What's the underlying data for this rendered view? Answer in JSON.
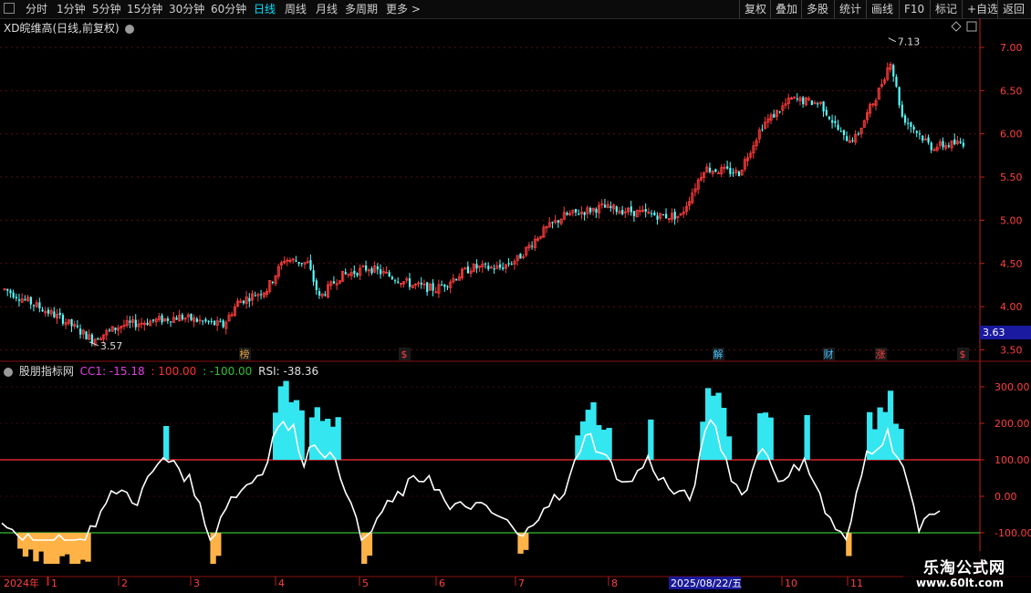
{
  "toolbar": {
    "periods": [
      "分时",
      "1分钟",
      "5分钟",
      "15分钟",
      "30分钟",
      "60分钟",
      "日线",
      "周线",
      "月线",
      "多周期",
      "更多"
    ],
    "active": "日线",
    "more_arrow": ">",
    "right_items": [
      "复权",
      "叠加",
      "多股",
      "统计",
      "画线",
      "F10",
      "标记",
      "+自选",
      "返回"
    ]
  },
  "chart": {
    "title": "XD皖维高(日线,前复权)",
    "high_label": "7.13",
    "low_label": "3.57",
    "current_price_tag": "3.63",
    "price_ticks": [
      "7.00",
      "6.50",
      "6.00",
      "5.50",
      "5.00",
      "4.50",
      "4.00",
      "3.50"
    ],
    "event_markers": [
      {
        "text": "榜",
        "color": "#e0a040"
      },
      {
        "text": "$",
        "color": "#ff4040"
      },
      {
        "text": "解",
        "color": "#40c0ff"
      },
      {
        "text": "财",
        "color": "#40c0ff"
      },
      {
        "text": "涨",
        "color": "#ff4040"
      },
      {
        "text": "$",
        "color": "#ff4040"
      }
    ]
  },
  "indicator": {
    "name": "股朋指标网",
    "cc1": "CC1: -15.18",
    "up_value": ": 100.00",
    "down_value": ": -100.00",
    "rsi": "RSI: -38.36",
    "ticks": [
      "300.00",
      "200.00",
      "100.00",
      "0.00",
      "-100.00"
    ]
  },
  "date_axis": {
    "year_label": "2024年",
    "months": [
      "1",
      "2",
      "3",
      "4",
      "5",
      "6",
      "7",
      "8",
      "10",
      "11"
    ],
    "cursor_date": "2025/08/22/五"
  },
  "watermark": {
    "main": "乐淘公式网",
    "sub": "www.60lt.com"
  },
  "colors": {
    "up": "#ff3c3c",
    "down": "#54ffff",
    "rsi_line": "#ffffff",
    "upper": "#ff3030",
    "lower": "#30c030",
    "cyan_fill": "#33e6f0",
    "orange_fill": "#ffb347",
    "active_tab": "#00e5ff",
    "axis": "#c02020"
  },
  "icons": [
    "square-icon",
    "chevron-right-icon",
    "circle-icon",
    "diamond-icon",
    "panel-icon"
  ]
}
